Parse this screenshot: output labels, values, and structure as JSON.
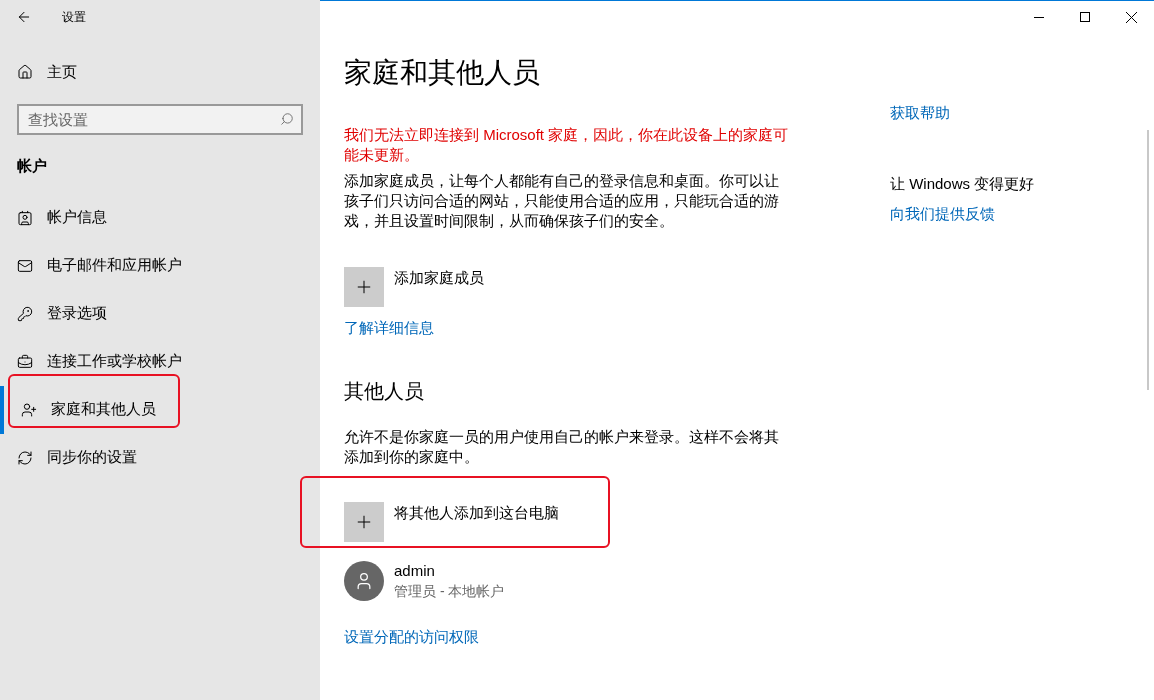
{
  "window": {
    "title": "设置"
  },
  "sidebar": {
    "home": "主页",
    "search": {
      "placeholder": "查找设置"
    },
    "section": "帐户",
    "items": [
      {
        "label": "帐户信息",
        "selected": false
      },
      {
        "label": "电子邮件和应用帐户",
        "selected": false
      },
      {
        "label": "登录选项",
        "selected": false
      },
      {
        "label": "连接工作或学校帐户",
        "selected": false
      },
      {
        "label": "家庭和其他人员",
        "selected": true
      },
      {
        "label": "同步你的设置",
        "selected": false
      }
    ]
  },
  "page": {
    "title": "家庭和其他人员",
    "warning": "我们无法立即连接到 Microsoft 家庭，因此，你在此设备上的家庭可能未更新。",
    "family_description": "添加家庭成员，让每个人都能有自己的登录信息和桌面。你可以让孩子们只访问合适的网站，只能使用合适的应用，只能玩合适的游戏，并且设置时间限制，从而确保孩子们的安全。",
    "add_family": "添加家庭成员",
    "learn_more": "了解详细信息",
    "others_heading": "其他人员",
    "others_description": "允许不是你家庭一员的用户使用自己的帐户来登录。这样不会将其添加到你的家庭中。",
    "add_other": "将其他人添加到这台电脑",
    "users": [
      {
        "name": "admin",
        "detail": "管理员 - 本地帐户"
      }
    ],
    "assigned_access": "设置分配的访问权限"
  },
  "aside": {
    "help": "获取帮助",
    "improve_heading": "让 Windows 变得更好",
    "feedback": "向我们提供反馈"
  }
}
